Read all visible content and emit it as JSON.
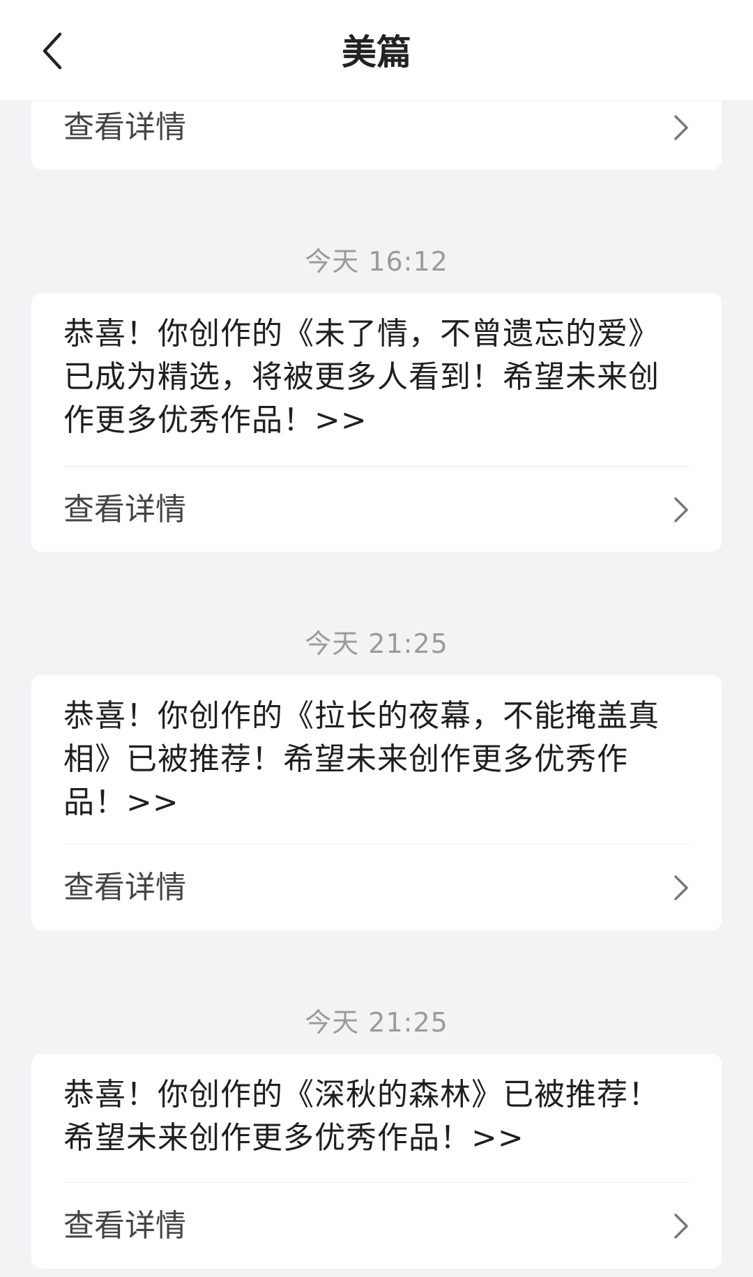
{
  "header": {
    "title": "美篇"
  },
  "detail_label": "查看详情",
  "messages": [
    {
      "time": "今天 16:12",
      "text": "恭喜！你创作的《未了情，不曾遗忘的爱》已成为精选，将被更多人看到！希望未来创作更多优秀作品！>>"
    },
    {
      "time": "今天 21:25",
      "text": "恭喜！你创作的《拉长的夜幕，不能掩盖真相》已被推荐！希望未来创作更多优秀作品！>>"
    },
    {
      "time": "今天 21:25",
      "text": "恭喜！你创作的《深秋的森林》已被推荐！希望未来创作更多优秀作品！>>"
    }
  ]
}
